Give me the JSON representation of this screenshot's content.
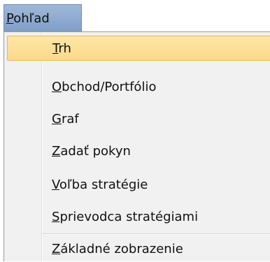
{
  "menubar": {
    "menu": {
      "mnemonic": "P",
      "rest": "ohľad"
    }
  },
  "dropdown": {
    "items": [
      {
        "mnemonic": "T",
        "rest": "rh",
        "highlighted": true
      },
      {
        "mnemonic": "O",
        "rest": "bchod/Portfólio"
      },
      {
        "mnemonic": "G",
        "rest": "raf"
      },
      {
        "mnemonic": "Z",
        "rest": "adať pokyn"
      },
      {
        "mnemonic": "V",
        "rest": "oľba stratégie"
      },
      {
        "mnemonic": "S",
        "rest": "prievodca stratégiami"
      },
      {
        "mnemonic": "Z",
        "rest": "ákladné zobrazenie"
      }
    ]
  }
}
